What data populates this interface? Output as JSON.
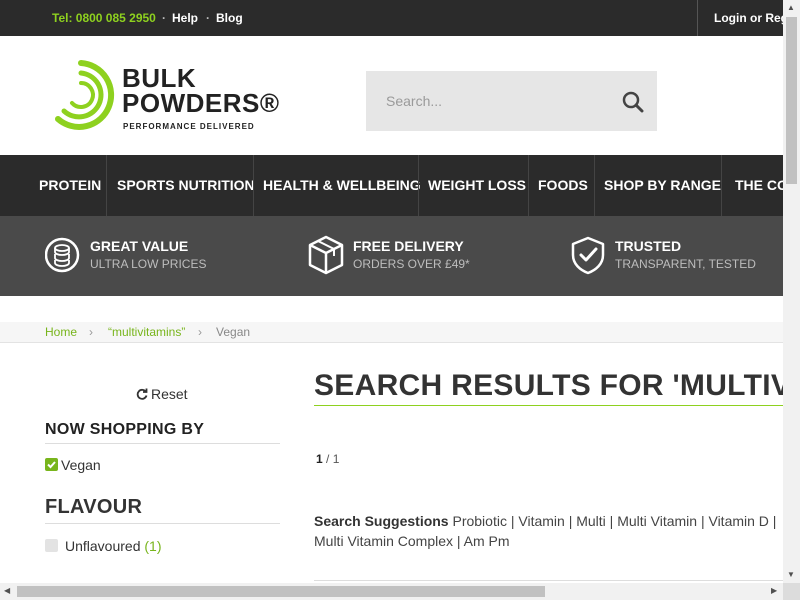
{
  "topbar": {
    "phone": "Tel: 0800 085 2950",
    "separator": "·",
    "help": "Help",
    "blog": "Blog",
    "login": "Login or Register"
  },
  "brand": {
    "line1": "BULK",
    "line2": "POWDERS®",
    "tagline": "PERFORMANCE DELIVERED",
    "accent_color": "#8ed11f"
  },
  "search": {
    "placeholder": "Search...",
    "icon": "search-icon"
  },
  "nav": {
    "items": [
      "PROTEIN",
      "SPORTS NUTRITION",
      "HEALTH & WELLBEING",
      "WEIGHT LOSS",
      "FOODS",
      "SHOP BY RANGE",
      "THE CORE"
    ]
  },
  "usp": [
    {
      "title": "GREAT VALUE",
      "subtitle": "ULTRA LOW PRICES",
      "icon": "coins-icon"
    },
    {
      "title": "FREE DELIVERY",
      "subtitle": "ORDERS OVER £49*",
      "icon": "box-icon"
    },
    {
      "title": "TRUSTED",
      "subtitle": "TRANSPARENT, TESTED",
      "icon": "shield-check-icon"
    }
  ],
  "breadcrumb": {
    "home": "Home",
    "query": "“multivitamins”",
    "current": "Vegan",
    "chevron": "›"
  },
  "sidebar": {
    "reset_label": "Reset",
    "shopping_by_heading": "NOW SHOPPING BY",
    "active_filter": "Vegan",
    "flavour_heading": "FLAVOUR",
    "flavour_option": "Unflavoured",
    "flavour_count": "(1)"
  },
  "results": {
    "title": "SEARCH RESULTS FOR 'MULTIVITAMINS'",
    "page_current": "1",
    "page_total": "/ 1",
    "suggest_label": "Search Suggestions",
    "suggestions": "Probiotic | Vitamin | Multi | Multi Vitamin | Vitamin D | Multi Vitamin Complex | Am Pm"
  }
}
